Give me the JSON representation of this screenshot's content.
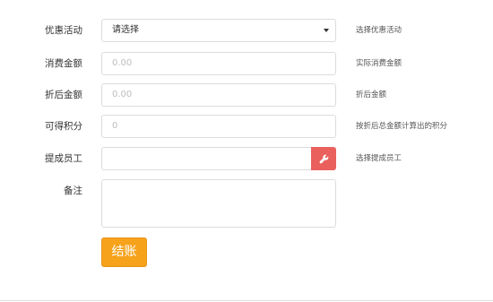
{
  "form": {
    "promotion": {
      "label": "优惠活动",
      "value": "请选择",
      "help": "选择优惠活动"
    },
    "amount": {
      "label": "消费金额",
      "placeholder": "0.00",
      "help": "实际消费金额"
    },
    "discounted": {
      "label": "折后金额",
      "placeholder": "0.00",
      "help": "折后金额"
    },
    "points": {
      "label": "可得积分",
      "placeholder": "0",
      "help": "按折后总金额计算出的积分"
    },
    "staff": {
      "label": "提成员工",
      "value": "",
      "help": "选择提成员工",
      "button_icon": "wrench-icon"
    },
    "remark": {
      "label": "备注",
      "value": ""
    },
    "submit_label": "结账"
  },
  "colors": {
    "submit": "#f7a21b",
    "staff_button": "#e9605c"
  }
}
